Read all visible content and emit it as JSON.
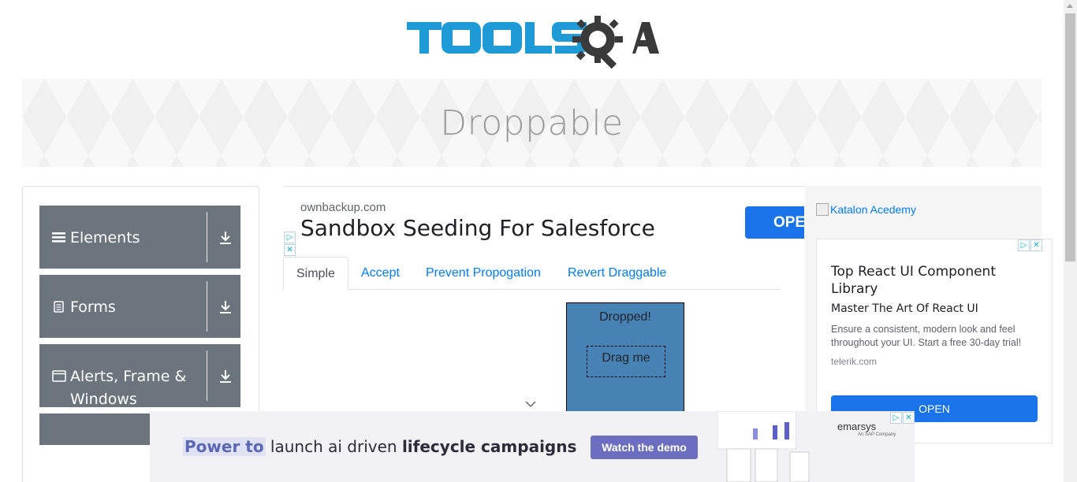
{
  "header": {
    "logo_text": "TOOLSQA",
    "page_title": "Droppable"
  },
  "sidebar": {
    "groups": [
      {
        "label": "Elements",
        "icon": "hamburger-icon"
      },
      {
        "label": "Forms",
        "icon": "document-icon"
      },
      {
        "label": "Alerts, Frame & Windows",
        "icon": "window-icon"
      }
    ]
  },
  "top_ad": {
    "domain": "ownbackup.com",
    "headline": "Sandbox Seeding For Salesforce",
    "cta": "OPEN"
  },
  "tabs": [
    {
      "label": "Simple",
      "active": true
    },
    {
      "label": "Accept",
      "active": false
    },
    {
      "label": "Prevent Propogation",
      "active": false
    },
    {
      "label": "Revert Draggable",
      "active": false
    }
  ],
  "droppable": {
    "drop_text": "Dropped!",
    "drag_text": "Drag me"
  },
  "right_ad": {
    "image_alt": "Katalon Acedemy",
    "title": "Top React UI Component Library",
    "subtitle": "Master The Art Of React UI",
    "description": "Ensure a consistent, modern look and feel throughout your UI. Start a free 30-day trial!",
    "domain": "telerik.com",
    "cta": "OPEN"
  },
  "bottom_ad": {
    "highlight": "Power to",
    "text_middle": " launch ai driven ",
    "text_bold": "lifecycle campaigns",
    "button": "Watch the demo",
    "brand": "emarsys",
    "brand_sub": "An SAP Company"
  },
  "colors": {
    "primary": "#007bff",
    "sidebar_group": "#6c757d",
    "drop_box": "#4682b4",
    "logo_blue": "#1e9bd7",
    "logo_dark": "#3a3a3a",
    "ad_button": "#1a73e8"
  }
}
